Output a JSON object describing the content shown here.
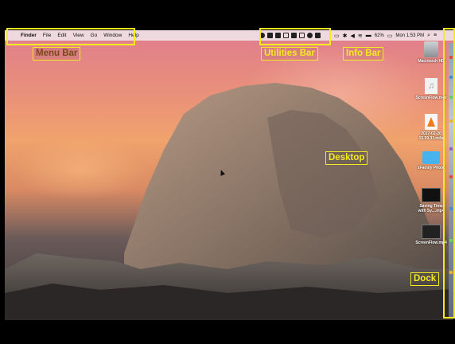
{
  "menubar": {
    "apple_glyph": "",
    "items": [
      "Finder",
      "File",
      "Edit",
      "View",
      "Go",
      "Window",
      "Help"
    ]
  },
  "status": {
    "battery": "62%",
    "clock": "Mon 1:53 PM"
  },
  "desktop_icons": [
    {
      "label": "Macintosh HD",
      "icon": "hard-drive-icon"
    },
    {
      "label": "ScreenFlow.m4v",
      "icon": "music-file-icon"
    },
    {
      "label": "2017-02-20 15.59.33.m4v",
      "icon": "vlc-file-icon"
    },
    {
      "label": "zFamily Photo",
      "icon": "folder-icon"
    },
    {
      "label": "Saving Time with Sy....mp4",
      "icon": "video-thumbnail-icon"
    },
    {
      "label": "ScreenFlow.mp4",
      "icon": "video-thumbnail-icon"
    }
  ],
  "annotations": {
    "menu_bar": "Menu Bar",
    "utilities_bar": "Utilities Bar",
    "info_bar": "Info Bar",
    "desktop": "Desktop",
    "dock": "Dock"
  },
  "colors": {
    "annotation": "#f5ea1f",
    "menubar_bg": "#f0e8ec"
  }
}
